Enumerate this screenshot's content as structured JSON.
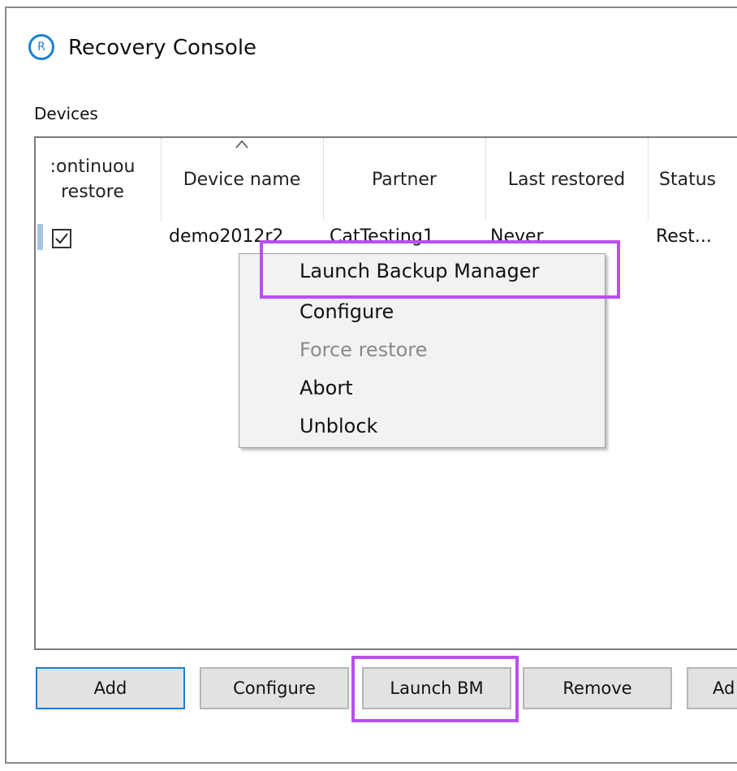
{
  "window": {
    "title": "Recovery Console",
    "icon": "recovery-logo-icon",
    "icon_letter": "R",
    "accent": "#1a7fd6"
  },
  "devices": {
    "label": "Devices",
    "columns": [
      "Continuous restore",
      "Device name",
      "Partner",
      "Last restored",
      "Status"
    ],
    "column_display": {
      "continuous_line1": ":ontinuou",
      "continuous_line2": "restore"
    },
    "sorted_column": "Device name",
    "rows": [
      {
        "continuous_restore": true,
        "device_name": "demo2012r2",
        "partner": "CatTesting1",
        "last_restored": "Never",
        "status": "Rest..."
      }
    ]
  },
  "context_menu": {
    "items": [
      {
        "label": "Launch Backup Manager",
        "enabled": true,
        "highlighted": true
      },
      {
        "label": "Configure",
        "enabled": true
      },
      {
        "label": "Force restore",
        "enabled": false
      },
      {
        "label": "Abort",
        "enabled": true
      },
      {
        "label": "Unblock",
        "enabled": true
      }
    ]
  },
  "buttons": {
    "add": "Add",
    "configure": "Configure",
    "launch_bm": "Launch BM",
    "remove": "Remove",
    "next": "Ad"
  },
  "colors": {
    "highlight": "#b84ff0",
    "default_button_border": "#1c7fd8"
  }
}
